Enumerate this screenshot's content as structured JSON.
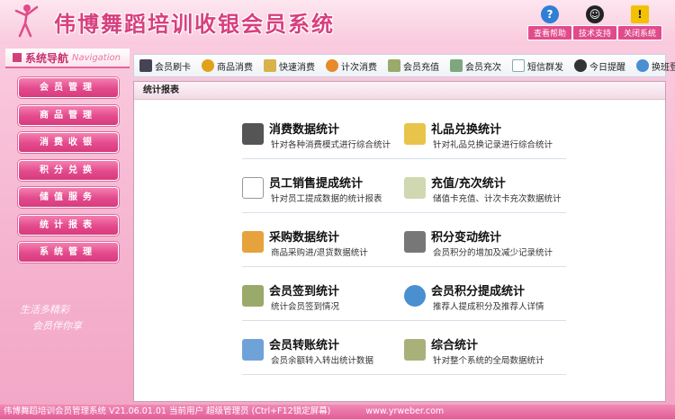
{
  "app": {
    "title": "伟博舞蹈培训收银会员系统"
  },
  "top_buttons": [
    {
      "label": "查看帮助",
      "icon": "help-icon",
      "color": "#2f7fd6"
    },
    {
      "label": "技术支持",
      "icon": "qq-icon",
      "color": "#222222"
    },
    {
      "label": "关闭系统",
      "icon": "warning-icon",
      "color": "#f2c200"
    }
  ],
  "sidebar": {
    "title": "系统导航",
    "title_en": "Navigation",
    "items": [
      {
        "label": "会员管理"
      },
      {
        "label": "商品管理"
      },
      {
        "label": "消费收银"
      },
      {
        "label": "积分兑换"
      },
      {
        "label": "储值服务"
      },
      {
        "label": "统计报表"
      },
      {
        "label": "系统管理"
      }
    ],
    "slogan_lines": [
      "生活多精彩",
      "会员伴你享"
    ]
  },
  "toolbar": {
    "items": [
      {
        "label": "会员刷卡",
        "icon": "card-reader-icon"
      },
      {
        "label": "商品消费",
        "icon": "money-bag-icon"
      },
      {
        "label": "快速消费",
        "icon": "fast-cart-icon"
      },
      {
        "label": "计次消费",
        "icon": "refresh-icon"
      },
      {
        "label": "会员充值",
        "icon": "wallet-icon"
      },
      {
        "label": "会员充次",
        "icon": "recharge-icon"
      },
      {
        "label": "短信群发",
        "icon": "mail-icon"
      },
      {
        "label": "今日提醒",
        "icon": "clock-icon"
      },
      {
        "label": "换班登录",
        "icon": "swap-icon"
      }
    ]
  },
  "panel": {
    "title": "统计报表",
    "stats": [
      {
        "title": "消费数据统计",
        "desc": "针对各种消费模式进行综合统计",
        "icon": "cash-register-icon"
      },
      {
        "title": "礼品兑换统计",
        "desc": "针对礼品兑换记录进行综合统计",
        "icon": "gift-card-icon"
      },
      {
        "title": "员工销售提成统计",
        "desc": "针对员工提成数据的统计报表",
        "icon": "chart-board-icon"
      },
      {
        "title": "充值/充次统计",
        "desc": "储值卡充值、计次卡充次数据统计",
        "icon": "recharge-card-icon"
      },
      {
        "title": "采购数据统计",
        "desc": "商品采购进/退货数据统计",
        "icon": "purchase-box-icon"
      },
      {
        "title": "积分变动统计",
        "desc": "会员积分的增加及减少记录统计",
        "icon": "points-icon"
      },
      {
        "title": "会员签到统计",
        "desc": "统计会员签到情况",
        "icon": "checkin-icon"
      },
      {
        "title": "会员积分提成统计",
        "desc": "推荐人提成积分及推荐人详情",
        "icon": "member-points-icon"
      },
      {
        "title": "会员转账统计",
        "desc": "会员余额转入转出统计数据",
        "icon": "transfer-icon"
      },
      {
        "title": "综合统计",
        "desc": "针对整个系统的全局数据统计",
        "icon": "overall-stats-icon"
      }
    ]
  },
  "statusbar": {
    "text": "伟博舞蹈培训会员管理系统 V21.06.01.01 当前用户 超级管理员 (Ctrl+F12锁定屏幕)",
    "url": "www.yrweber.com"
  }
}
